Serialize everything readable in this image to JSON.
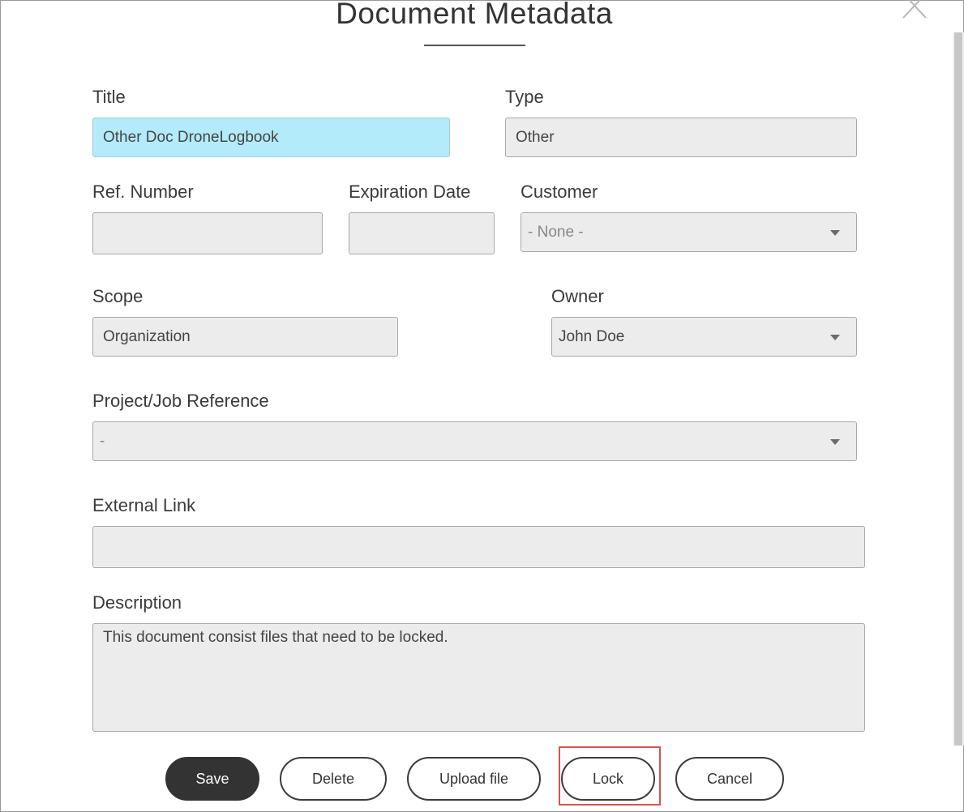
{
  "dialog": {
    "title": "Document Metadata"
  },
  "fields": {
    "title": {
      "label": "Title",
      "value": "Other Doc DroneLogbook"
    },
    "type": {
      "label": "Type",
      "value": "Other"
    },
    "ref_number": {
      "label": "Ref. Number",
      "value": ""
    },
    "expiration_date": {
      "label": "Expiration Date",
      "value": ""
    },
    "customer": {
      "label": "Customer",
      "value": "- None -"
    },
    "scope": {
      "label": "Scope",
      "value": "Organization"
    },
    "owner": {
      "label": "Owner",
      "value": "John Doe"
    },
    "project_job_reference": {
      "label": "Project/Job Reference",
      "value": "-"
    },
    "external_link": {
      "label": "External Link",
      "value": ""
    },
    "description": {
      "label": "Description",
      "value": "This document consist files that need to be locked."
    }
  },
  "buttons": {
    "save": "Save",
    "delete": "Delete",
    "upload_file": "Upload file",
    "lock": "Lock",
    "cancel": "Cancel"
  },
  "colors": {
    "highlight_field": "#b3ebfa",
    "primary_button": "#333333",
    "focus_outline": "#d9534f"
  },
  "icons": {
    "close": "close-icon",
    "dropdown": "chevron-down-icon"
  }
}
